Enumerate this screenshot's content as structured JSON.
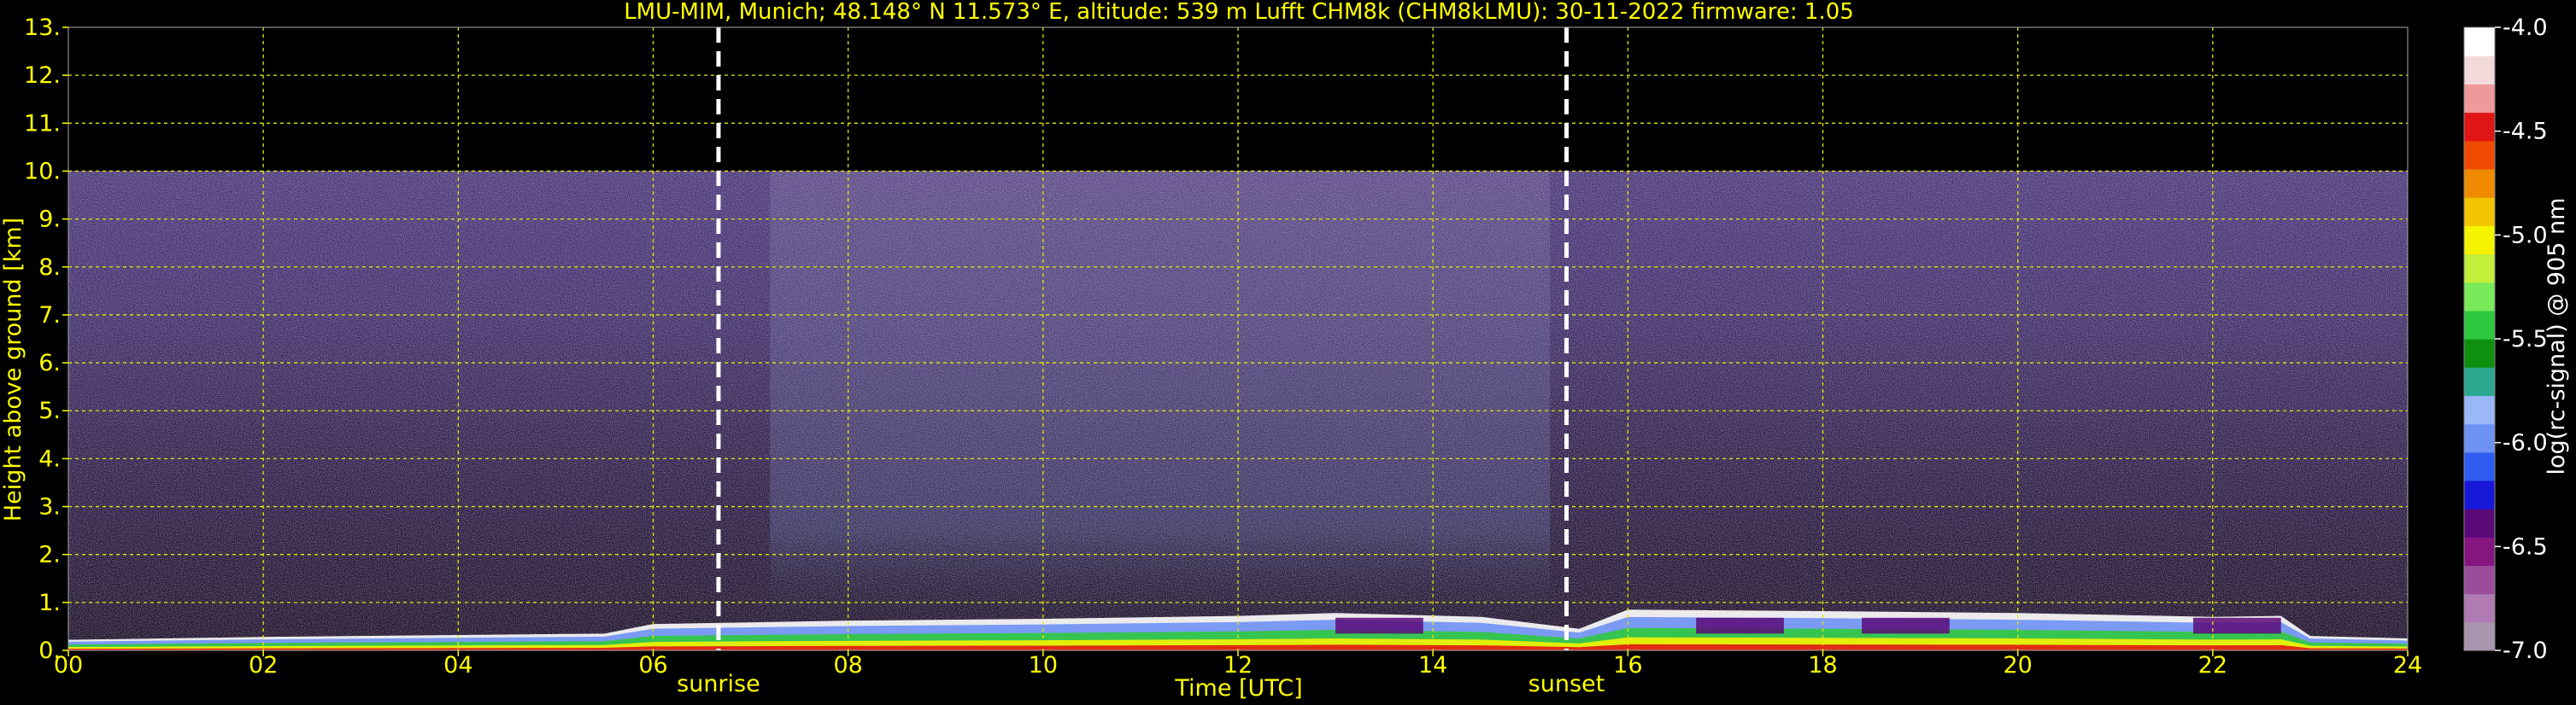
{
  "chart_data": {
    "type": "heatmap",
    "title": "LMU-MIM, Munich; 48.148° N 11.573° E, altitude: 539 m    Lufft CHM8k (CHM8kLMU): 30-11-2022    firmware: 1.05",
    "xlabel": "Time [UTC]",
    "ylabel": "Height above ground [km]",
    "xlim": [
      0,
      24
    ],
    "ylim": [
      0,
      13
    ],
    "x_ticks": [
      "00",
      "02",
      "04",
      "06",
      "08",
      "10",
      "12",
      "14",
      "16",
      "18",
      "20",
      "22",
      "24"
    ],
    "y_ticks": [
      "0.",
      "1.",
      "2.",
      "3.",
      "4.",
      "5.",
      "6.",
      "7.",
      "8.",
      "9.",
      "10.",
      "11.",
      "12.",
      "13."
    ],
    "grid": true,
    "signal_top_km": 10.0,
    "vertical_markers": [
      {
        "label": "sunrise",
        "x": 6.67
      },
      {
        "label": "sunset",
        "x": 15.37
      }
    ],
    "colorbar": {
      "label": "log(rc-signal) @ 905 nm",
      "range": [
        -7.0,
        -4.0
      ],
      "ticks": [
        "-4.0",
        "-4.5",
        "-5.0",
        "-5.5",
        "-6.0",
        "-6.5",
        "-7.0"
      ],
      "colors": [
        "#a896ae",
        "#b07bb2",
        "#9a4d9a",
        "#86167f",
        "#5a0a78",
        "#1818d8",
        "#2f5cf0",
        "#6e91f4",
        "#9ab8f8",
        "#2aa890",
        "#0f8f0f",
        "#2fc93f",
        "#79ea5a",
        "#c3ee3a",
        "#f5f400",
        "#f3c400",
        "#f08a00",
        "#ef4a00",
        "#e01616",
        "#ef9a9a",
        "#f3dada",
        "#ffffff"
      ]
    },
    "boundary_layer_height_km": [
      {
        "x": 0.0,
        "y": 0.22
      },
      {
        "x": 2.0,
        "y": 0.28
      },
      {
        "x": 4.0,
        "y": 0.32
      },
      {
        "x": 5.5,
        "y": 0.35
      },
      {
        "x": 6.0,
        "y": 0.55
      },
      {
        "x": 8.0,
        "y": 0.62
      },
      {
        "x": 10.0,
        "y": 0.66
      },
      {
        "x": 12.0,
        "y": 0.72
      },
      {
        "x": 13.0,
        "y": 0.78
      },
      {
        "x": 14.5,
        "y": 0.7
      },
      {
        "x": 15.5,
        "y": 0.45
      },
      {
        "x": 16.0,
        "y": 0.85
      },
      {
        "x": 18.0,
        "y": 0.82
      },
      {
        "x": 20.0,
        "y": 0.78
      },
      {
        "x": 22.0,
        "y": 0.7
      },
      {
        "x": 22.7,
        "y": 0.72
      },
      {
        "x": 23.0,
        "y": 0.3
      },
      {
        "x": 24.0,
        "y": 0.25
      }
    ]
  }
}
